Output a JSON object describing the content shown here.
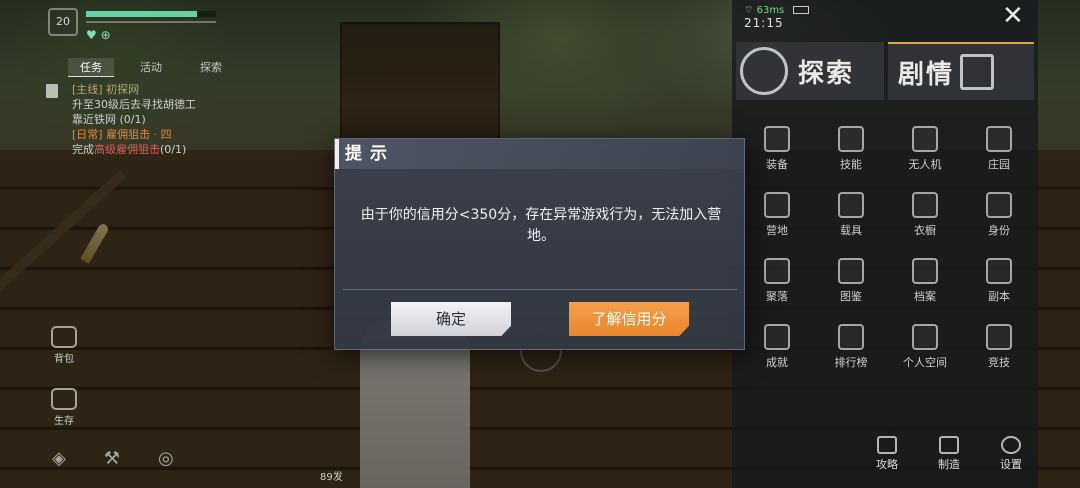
{
  "hud": {
    "level": "20",
    "hp_fraction": 0.85,
    "status_icons": "♥ ⊕"
  },
  "quest": {
    "tabs": [
      "任务",
      "活动",
      "探索"
    ],
    "main_tag": "[主线] 初探网",
    "main_line1": "升至30级后去寻找胡德工",
    "main_line2": "靠近铁网 (0/1)",
    "side_tag": "[日常] 雇佣狙击 · 四",
    "side_line_prefix": "完成",
    "side_line_highlight": "高级雇佣狙击",
    "side_line_suffix": "(0/1)"
  },
  "left_dock": {
    "backpack": "背包",
    "survive": "生存"
  },
  "bottom_hud": {
    "ammo": "89发"
  },
  "status": {
    "ping": "63ms",
    "time": "21:15"
  },
  "menu": {
    "explore_tab": "探索",
    "story_tab": "剧情",
    "grid": [
      {
        "label": "装备",
        "icon": "gun-icon"
      },
      {
        "label": "技能",
        "icon": "skill-icon"
      },
      {
        "label": "无人机",
        "icon": "drone-icon"
      },
      {
        "label": "庄园",
        "icon": "house-icon"
      },
      {
        "label": "营地",
        "icon": "camp-flag-icon"
      },
      {
        "label": "载具",
        "icon": "vehicle-icon"
      },
      {
        "label": "衣橱",
        "icon": "wardrobe-icon"
      },
      {
        "label": "身份",
        "icon": "id-card-icon"
      },
      {
        "label": "聚落",
        "icon": "settlement-icon"
      },
      {
        "label": "图鉴",
        "icon": "gallery-icon"
      },
      {
        "label": "档案",
        "icon": "archive-icon"
      },
      {
        "label": "副本",
        "icon": "dungeon-icon"
      },
      {
        "label": "成就",
        "icon": "achievement-icon"
      },
      {
        "label": "排行榜",
        "icon": "leaderboard-icon"
      },
      {
        "label": "个人空间",
        "icon": "profile-icon"
      },
      {
        "label": "竞技",
        "icon": "trophy-icon"
      }
    ],
    "footer": {
      "guide": "攻略",
      "craft": "制造",
      "settings": "设置"
    }
  },
  "dialog": {
    "title": "提示",
    "message": "由于你的信用分<350分，存在异常游戏行为，无法加入营地。",
    "confirm": "确定",
    "learn_credit": "了解信用分"
  },
  "colors": {
    "accent_orange": "#e9852b",
    "hp_green": "#69d1a6"
  }
}
